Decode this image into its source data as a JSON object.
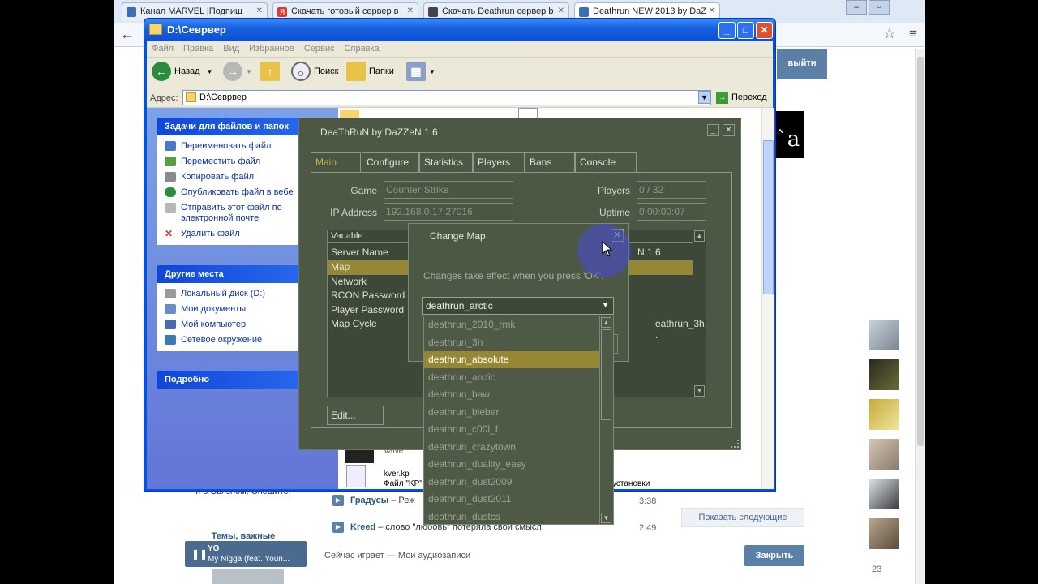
{
  "browser": {
    "tabs": [
      {
        "title": "Канал MARVEL |Подпиш",
        "color": "#3b6fb6"
      },
      {
        "title": "Скачать готовый сервер в",
        "color": "#e23b2e"
      },
      {
        "title": "Скачать Deathrun сервер b",
        "color": "#444444"
      },
      {
        "title": "Deathrun NEW 2013 by DaZ",
        "color": "#3b6fb6"
      }
    ]
  },
  "vk": {
    "logout": "выйти",
    "black_tile": "`a",
    "left_note": "II в Связном. Спешите!",
    "topics": "Темы, важные",
    "player_title": "YG",
    "player_track": "My Nigga (feat. Youn...",
    "tracks": [
      {
        "artist": "Градусы",
        "title": "– Реж",
        "time": "3:38"
      },
      {
        "artist": "Kreed",
        "title": "– слово \"любовь\" потеряла свой смысл.",
        "time": "2:49"
      }
    ],
    "now_playing": "Сейчас играет — Мои аудиозаписи",
    "show_next": "Показать следующие",
    "close_btn": "Закрыть",
    "friends_count": "23"
  },
  "explorer": {
    "title": "D:\\Севрвер",
    "menu": [
      "Файл",
      "Правка",
      "Вид",
      "Избранное",
      "Сервис",
      "Справка"
    ],
    "back": "Назад",
    "search": "Поиск",
    "folders": "Папки",
    "address_label": "Адрес:",
    "address": "D:\\Севрвер",
    "go": "Переход",
    "tasks_header": "Задачи для файлов и папок",
    "tasks": [
      {
        "label": "Переименовать файл",
        "color": "#4a78c8"
      },
      {
        "label": "Переместить файл",
        "color": "#5a9c48"
      },
      {
        "label": "Копировать файл",
        "color": "#8a8a8a"
      },
      {
        "label": "Опубликовать файл в вебе",
        "color": "#2a8c3c"
      },
      {
        "label": "Отправить этот файл по электронной почте",
        "color": "#b8b8b8"
      },
      {
        "label": "Удалить файл",
        "color": "#d23c2c"
      }
    ],
    "places_header": "Другие места",
    "places": [
      {
        "label": "Локальный диск (D:)",
        "color": "#9a9a9a"
      },
      {
        "label": "Мои документы",
        "color": "#6b8bc8"
      },
      {
        "label": "Мой компьютер",
        "color": "#4a6ab0"
      },
      {
        "label": "Сетевое окружение",
        "color": "#3a7ab8"
      }
    ],
    "details_header": "Подробно",
    "file_name": "kver.kp",
    "file_type": "Файл \"KP\"",
    "file_desc": "установки",
    "file_valve": "Valve"
  },
  "app": {
    "title": "DeaThRuN by DaZZeN 1.6",
    "tabs": [
      "Main",
      "Configure",
      "Statistics",
      "Players",
      "Bans",
      "Console"
    ],
    "game_label": "Game",
    "game_value": "Counter-Strike",
    "ip_label": "IP Address",
    "ip_value": "192.168.0.17:27016",
    "players_label": "Players",
    "players_value": "0 / 32",
    "uptime_label": "Uptime",
    "uptime_value": "0:00:00:07",
    "col_variable": "Variable",
    "rows": [
      "Server Name",
      "Map",
      "Network",
      "RCON Password",
      "Player Password",
      "Map Cycle"
    ],
    "server_name_value": "N 1.6",
    "map_cycle_value": "eathrun_3h, .",
    "edit": "Edit..."
  },
  "dialog": {
    "title": "Change Map",
    "message": "Changes take effect when you press 'OK'.",
    "selected": "deathrun_arctic",
    "maps": [
      "deathrun_2010_rmk",
      "deathrun_3h",
      "deathrun_absolute",
      "deathrun_arctic",
      "deathrun_baw",
      "deathrun_bieber",
      "deathrun_c00l_f",
      "deathrun_crazytown",
      "deathrun_duality_easy",
      "deathrun_dust2009",
      "deathrun_dust2011",
      "deathrun_dustcs"
    ],
    "highlighted_index": 2
  }
}
